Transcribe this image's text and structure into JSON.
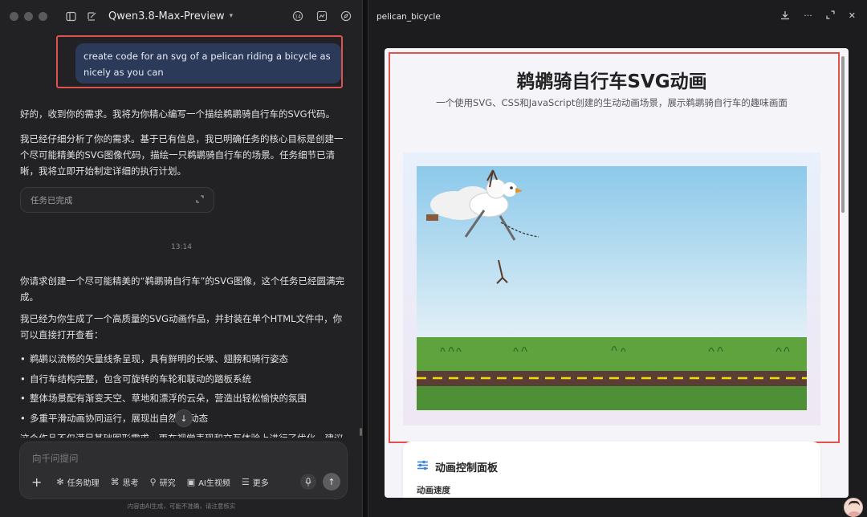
{
  "left": {
    "model_name": "Qwen3.8-Max-Preview",
    "user_message": "create code for an svg of a pelican riding a bicycle as nicely as you can",
    "ai_para1": "好的，收到你的需求。我将为你精心编写一个描绘鹈鹕骑自行车的SVG代码。",
    "ai_para2": "我已经仔细分析了你的需求。基于已有信息，我已明确任务的核心目标是创建一个尽可能精美的SVG图像代码，描绘一只鹈鹕骑自行车的场景。任务细节已清晰，我将立即开始制定详细的执行计划。",
    "task_status": "任务已完成",
    "timestamp": "13:14",
    "ai_para3": "你请求创建一个尽可能精美的“鹈鹕骑自行车”的SVG图像，这个任务已经圆满完成。",
    "ai_para4": "我已经为你生成了一个高质量的SVG动画作品，并封装在单个HTML文件中，你可以直接打开查看：",
    "bullets": [
      "鹈鹕以流畅的矢量线条呈现，具有鲜明的长喙、翅膀和骑行姿态",
      "自行车结构完整，包含可旋转的车轮和联动的踏板系统",
      "整体场景配有渐变天空、草地和漂浮的云朵，营造出轻松愉快的氛围",
      "多重平滑动画协同运行，展现出自然      行动态"
    ],
    "clipped_line": "这个作品不仅满足基础图形需求，更在视觉表现和交互体验上进行了优化。建议",
    "input_placeholder": "向千问提问",
    "tools": [
      {
        "icon": "sparkle-icon",
        "label": "任务助理"
      },
      {
        "icon": "brain-icon",
        "label": "思考"
      },
      {
        "icon": "telescope-icon",
        "label": "研究"
      },
      {
        "icon": "video-icon",
        "label": "AI生视频"
      },
      {
        "icon": "more-lines-icon",
        "label": "更多"
      }
    ],
    "disclaimer": "内容由AI生成，可能不准确，请注意核实"
  },
  "right": {
    "title": "pelican_bicycle",
    "preview": {
      "heading": "鹈鹕骑自行车SVG动画",
      "subtitle": "一个使用SVG、CSS和JavaScript创建的生动动画场景，展示鹈鹕骑自行车的趣味画面",
      "panel_title": "动画控制面板",
      "speed_label": "动画速度"
    }
  },
  "colors": {
    "highlight": "#e0524d",
    "user_bubble": "#2c3a5a",
    "accent_blue": "#3a82d8",
    "sky_top": "#8cc9ea",
    "grass": "#5fa33f",
    "road": "#5a3e36",
    "road_dash": "#f5d90a"
  }
}
